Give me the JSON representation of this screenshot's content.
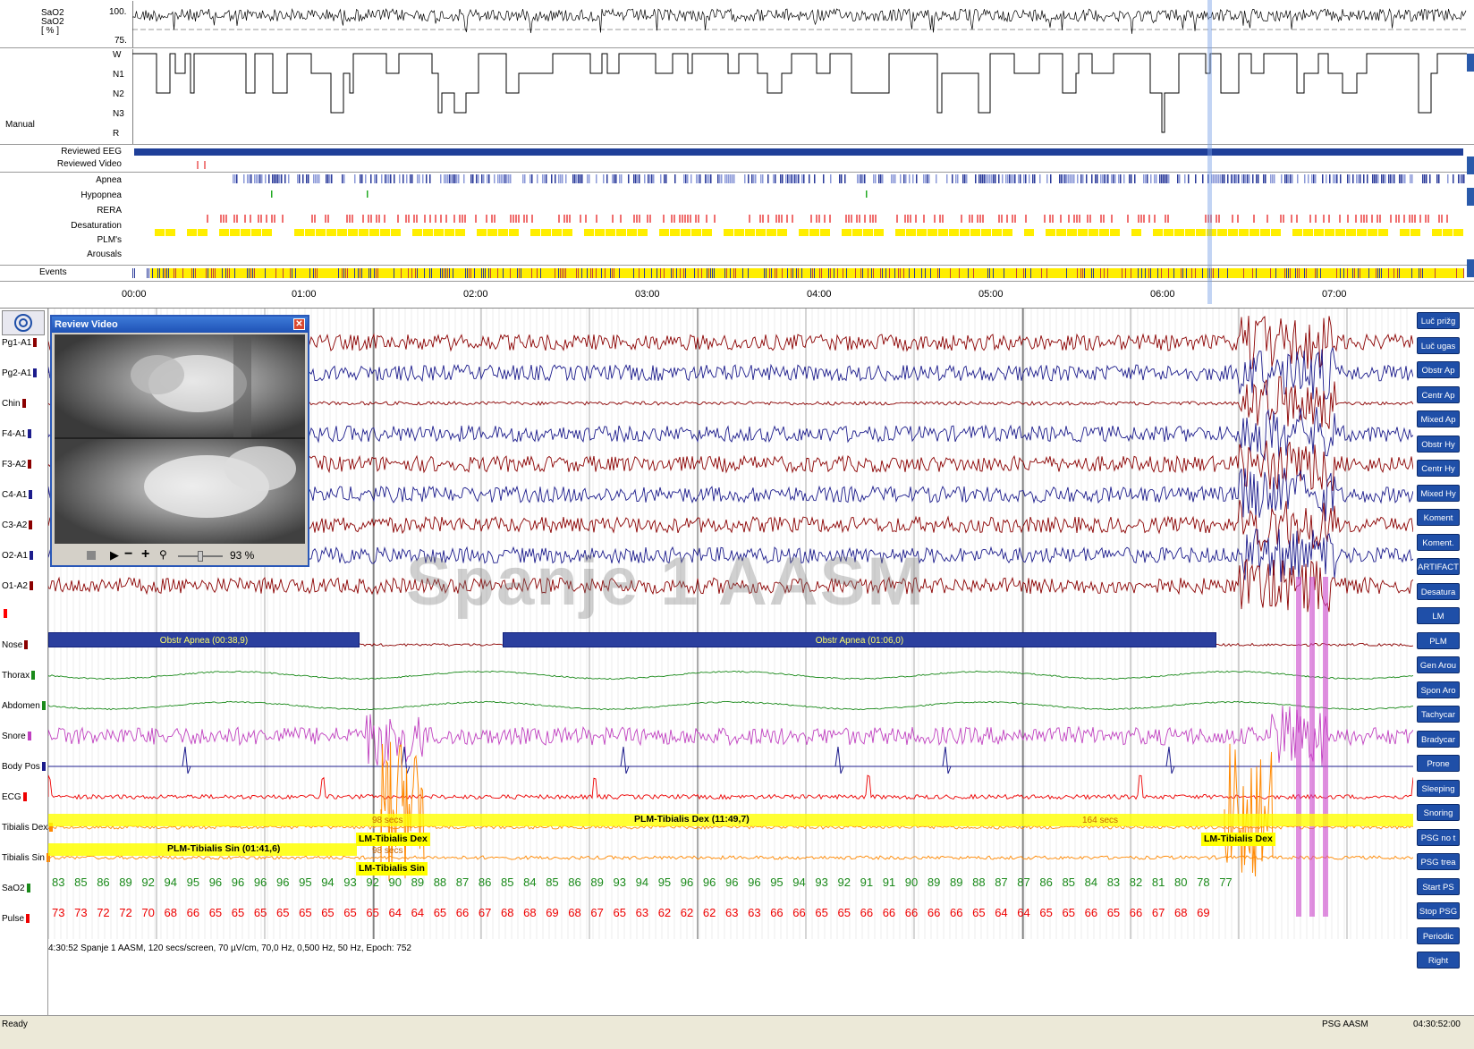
{
  "overview": {
    "sao2_labels": [
      "SaO2",
      "SaO2",
      "[ % ]"
    ],
    "sao2_ticks": [
      "100.",
      "75."
    ],
    "hypno_label": "Manual",
    "hypno_stages": [
      "W",
      "N1",
      "N2",
      "N3",
      "R"
    ],
    "reviewed_eeg": "Reviewed EEG",
    "reviewed_video": "Reviewed Video",
    "event_rows": [
      "Apnea",
      "Hypopnea",
      "RERA",
      "Desaturation",
      "PLM's",
      "Arousals"
    ],
    "events_label": "Events",
    "time_ticks": [
      "00:00",
      "01:00",
      "02:00",
      "03:00",
      "04:00",
      "05:00",
      "06:00",
      "07:00"
    ]
  },
  "channels": [
    {
      "label": "Pg1-A1",
      "color": "#8b0000"
    },
    {
      "label": "Pg2-A1",
      "color": "#1c1c8c"
    },
    {
      "label": "Chin",
      "color": "#8b0000"
    },
    {
      "label": "F4-A1",
      "color": "#1c1c8c"
    },
    {
      "label": "F3-A2",
      "color": "#8b0000"
    },
    {
      "label": "C4-A1",
      "color": "#1c1c8c"
    },
    {
      "label": "C3-A2",
      "color": "#8b0000"
    },
    {
      "label": "O2-A1",
      "color": "#1c1c8c"
    },
    {
      "label": "O1-A2",
      "color": "#8b0000"
    },
    {
      "label": "",
      "color": "#ff0000"
    },
    {
      "label": "Nose",
      "color": "#8b0000"
    },
    {
      "label": "Thorax",
      "color": "#1a8a1a"
    },
    {
      "label": "Abdomen",
      "color": "#1a8a1a"
    },
    {
      "label": "Snore",
      "color": "#c040c0"
    },
    {
      "label": "Body Pos",
      "color": "#1c1c8c"
    },
    {
      "label": "ECG",
      "color": "#ee0000"
    },
    {
      "label": "Tibialis Dex",
      "color": "#ff8800"
    },
    {
      "label": "Tibialis Sin",
      "color": "#ff8800"
    },
    {
      "label": "SaO2",
      "color": "#1a8a1a"
    },
    {
      "label": "Pulse",
      "color": "#ee0000"
    }
  ],
  "events": {
    "obstr1": "Obstr Apnea (00:38,9)",
    "obstr2": "Obstr Apnea (01:06,0)",
    "plm_dex": "PLM-Tibialis Dex (11:49,7)",
    "plm_sin": "PLM-Tibialis Sin (01:41,6)",
    "lm_dex1": "LM-Tibialis Dex",
    "lm_sin": "LM-Tibialis Sin",
    "lm_dex2": "LM-Tibialis Dex",
    "secs1": "98 secs",
    "secs2": "98 secs",
    "secs3": "164 secs"
  },
  "watermark": "Spanje 1 AASM",
  "sao2_values": [
    "83",
    "85",
    "86",
    "89",
    "92",
    "94",
    "95",
    "96",
    "96",
    "96",
    "96",
    "95",
    "94",
    "93",
    "92",
    "90",
    "89",
    "88",
    "87",
    "86",
    "85",
    "84",
    "85",
    "86",
    "89",
    "93",
    "94",
    "95",
    "96",
    "96",
    "96",
    "96",
    "95",
    "94",
    "93",
    "92",
    "91",
    "91",
    "90",
    "89",
    "89",
    "88",
    "87",
    "87",
    "86",
    "85",
    "84",
    "83",
    "82",
    "81",
    "80",
    "78",
    "77"
  ],
  "pulse_values": [
    "73",
    "73",
    "72",
    "72",
    "70",
    "68",
    "66",
    "65",
    "65",
    "65",
    "65",
    "65",
    "65",
    "65",
    "65",
    "64",
    "64",
    "65",
    "66",
    "67",
    "68",
    "68",
    "69",
    "68",
    "67",
    "65",
    "63",
    "62",
    "62",
    "62",
    "63",
    "63",
    "66",
    "66",
    "65",
    "65",
    "66",
    "66",
    "66",
    "66",
    "66",
    "65",
    "64",
    "64",
    "65",
    "65",
    "66",
    "65",
    "66",
    "67",
    "68",
    "69"
  ],
  "video": {
    "title": "Review Video",
    "zoom": "93 %"
  },
  "right_buttons": [
    "Luč prižg",
    "Luč ugas",
    "Obstr Ap",
    "Centr Ap",
    "Mixed Ap",
    "Obstr Hy",
    "Centr Hy",
    "Mixed Hy",
    "Koment",
    "Koment.",
    "ARTIFACT",
    "Desatura",
    "LM",
    "PLM",
    "Gen Arou",
    "Spon Aro",
    "Tachycar",
    "Bradycar",
    "Prone",
    "Sleeping",
    "Snoring",
    "PSG no t",
    "PSG trea",
    "Start PS",
    "Stop PSG",
    "Periodic",
    "Right"
  ],
  "info_line": "4:30:52 Spanje 1 AASM, 120 secs/screen, 70 µV/cm, 70,0 Hz, 0,500 Hz, 50 Hz, Epoch: 752",
  "status": {
    "left": "Ready",
    "mid": "PSG AASM",
    "right": "04:30:52:00"
  },
  "colors": {
    "eeg_red": "#8b0000",
    "eeg_blue": "#1c1c8c",
    "resp_green": "#1a8a1a",
    "snore": "#c040c0",
    "ecg": "#ee0000",
    "emg": "#ff8800",
    "highlight": "#ffff00",
    "button": "#1f4fa8"
  }
}
